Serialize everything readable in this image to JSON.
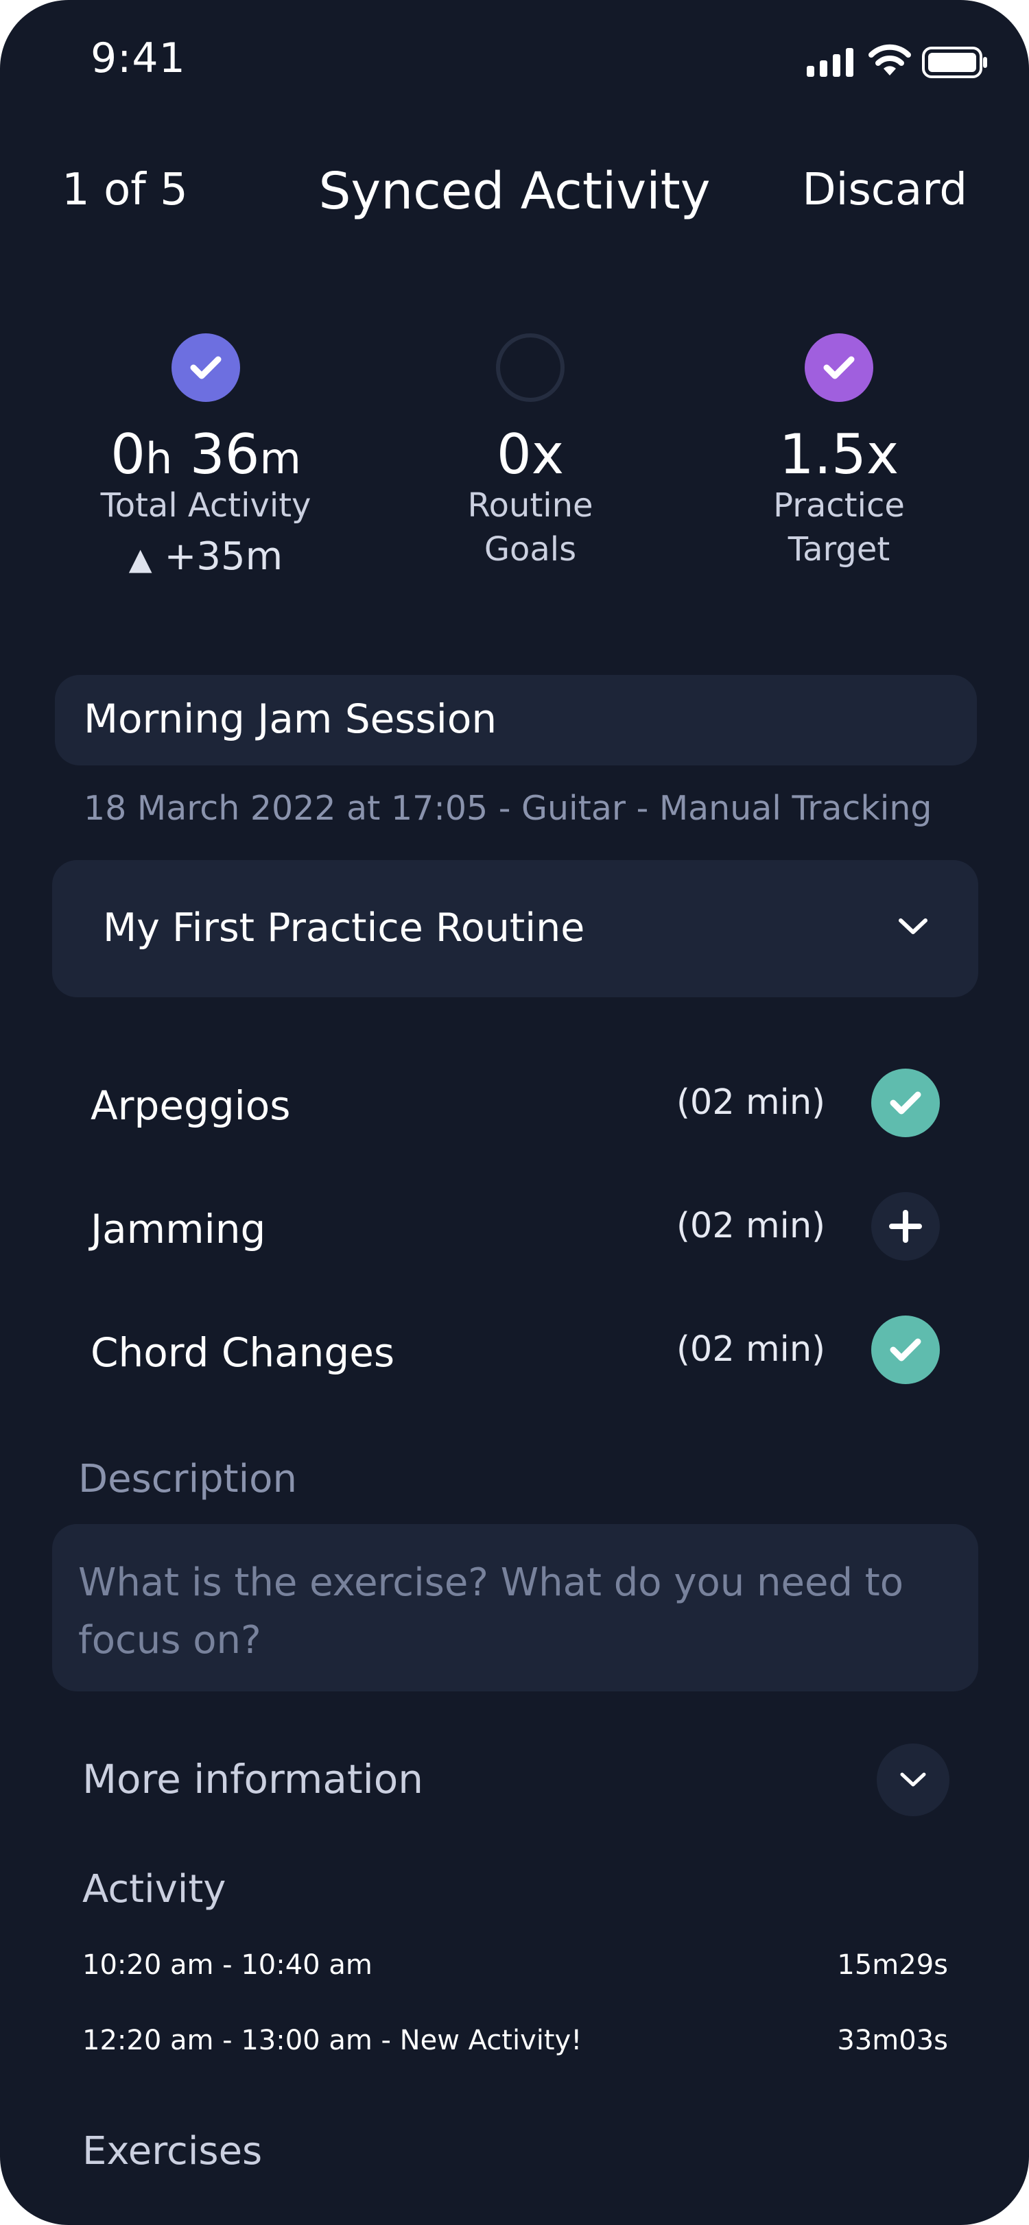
{
  "status_bar": {
    "time": "9:41"
  },
  "header": {
    "counter": "1 of 5",
    "title": "Synced Activity",
    "discard_label": "Discard"
  },
  "stats": {
    "total_activity": {
      "hours": "0",
      "hours_unit": "h",
      "minutes": "36",
      "minutes_unit": "m",
      "label": "Total Activity",
      "delta": "+35m",
      "status": "completed",
      "color": "#6d6fe0"
    },
    "routine_goals": {
      "value": "0x",
      "label_line1": "Routine",
      "label_line2": "Goals",
      "status": "not-completed"
    },
    "practice_target": {
      "value": "1.5x",
      "label_line1": "Practice",
      "label_line2": "Target",
      "status": "completed",
      "color": "#a05fde"
    }
  },
  "session": {
    "name": "Morning Jam Session",
    "meta": "18 March 2022 at 17:05 - Guitar - Manual Tracking"
  },
  "routine": {
    "selected": "My First Practice Routine"
  },
  "exercises": [
    {
      "name": "Arpeggios",
      "duration": "(02 min)",
      "state": "done"
    },
    {
      "name": "Jamming",
      "duration": "(02 min)",
      "state": "add"
    },
    {
      "name": "Chord Changes",
      "duration": "(02 min)",
      "state": "done"
    }
  ],
  "description": {
    "label": "Description",
    "placeholder": "What is the exercise? What do you need to focus on?"
  },
  "more_info": {
    "label": "More information"
  },
  "activity": {
    "label": "Activity",
    "rows": [
      {
        "range": "10:20 am - 10:40 am",
        "duration": "15m29s"
      },
      {
        "range": "12:20 am - 13:00 am  - New Activity!",
        "duration": "33m03s"
      }
    ]
  },
  "exercises_section": {
    "label": "Exercises"
  },
  "colors": {
    "background": "#131928",
    "card": "#1d2538",
    "done": "#5fbcae"
  }
}
